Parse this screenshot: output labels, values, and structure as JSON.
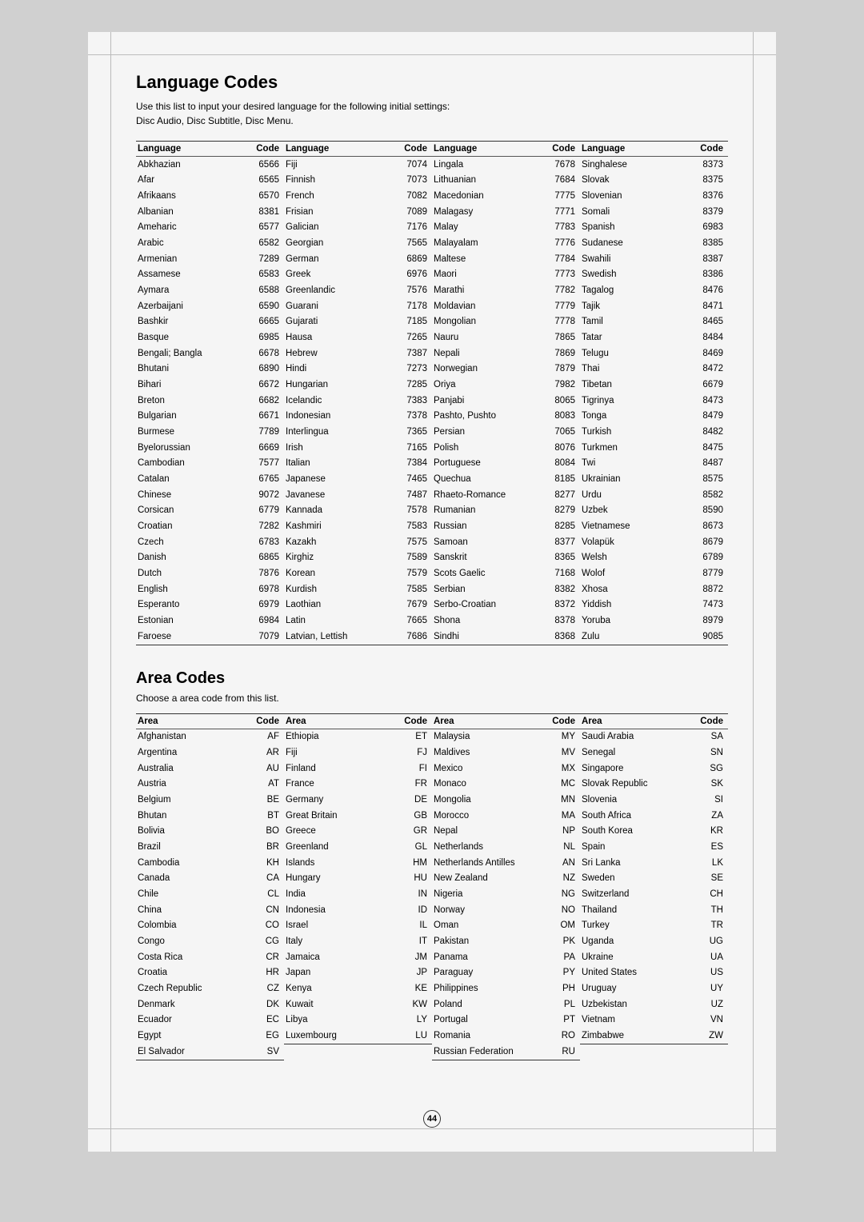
{
  "page": {
    "title": "Language Codes",
    "description_line1": "Use this list to input your desired language for the following initial settings:",
    "description_line2": "Disc Audio, Disc Subtitle, Disc Menu.",
    "area_title": "Area Codes",
    "area_desc": "Choose a area code from this list.",
    "page_number": "44"
  },
  "language_columns": [
    {
      "header": {
        "language": "Language",
        "code": "Code"
      },
      "rows": [
        {
          "language": "Abkhazian",
          "code": "6566"
        },
        {
          "language": "Afar",
          "code": "6565"
        },
        {
          "language": "Afrikaans",
          "code": "6570"
        },
        {
          "language": "Albanian",
          "code": "8381"
        },
        {
          "language": "Ameharic",
          "code": "6577"
        },
        {
          "language": "Arabic",
          "code": "6582"
        },
        {
          "language": "Armenian",
          "code": "7289"
        },
        {
          "language": "Assamese",
          "code": "6583"
        },
        {
          "language": "Aymara",
          "code": "6588"
        },
        {
          "language": "Azerbaijani",
          "code": "6590"
        },
        {
          "language": "Bashkir",
          "code": "6665"
        },
        {
          "language": "Basque",
          "code": "6985"
        },
        {
          "language": "Bengali; Bangla",
          "code": "6678"
        },
        {
          "language": "Bhutani",
          "code": "6890"
        },
        {
          "language": "Bihari",
          "code": "6672"
        },
        {
          "language": "Breton",
          "code": "6682"
        },
        {
          "language": "Bulgarian",
          "code": "6671"
        },
        {
          "language": "Burmese",
          "code": "7789"
        },
        {
          "language": "Byelorussian",
          "code": "6669"
        },
        {
          "language": "Cambodian",
          "code": "7577"
        },
        {
          "language": "Catalan",
          "code": "6765"
        },
        {
          "language": "Chinese",
          "code": "9072"
        },
        {
          "language": "Corsican",
          "code": "6779"
        },
        {
          "language": "Croatian",
          "code": "7282"
        },
        {
          "language": "Czech",
          "code": "6783"
        },
        {
          "language": "Danish",
          "code": "6865"
        },
        {
          "language": "Dutch",
          "code": "7876"
        },
        {
          "language": "English",
          "code": "6978"
        },
        {
          "language": "Esperanto",
          "code": "6979"
        },
        {
          "language": "Estonian",
          "code": "6984"
        },
        {
          "language": "Faroese",
          "code": "7079"
        }
      ]
    },
    {
      "header": {
        "language": "Language",
        "code": "Code"
      },
      "rows": [
        {
          "language": "Fiji",
          "code": "7074"
        },
        {
          "language": "Finnish",
          "code": "7073"
        },
        {
          "language": "French",
          "code": "7082"
        },
        {
          "language": "Frisian",
          "code": "7089"
        },
        {
          "language": "Galician",
          "code": "7176"
        },
        {
          "language": "Georgian",
          "code": "7565"
        },
        {
          "language": "German",
          "code": "6869"
        },
        {
          "language": "Greek",
          "code": "6976"
        },
        {
          "language": "Greenlandic",
          "code": "7576"
        },
        {
          "language": "Guarani",
          "code": "7178"
        },
        {
          "language": "Gujarati",
          "code": "7185"
        },
        {
          "language": "Hausa",
          "code": "7265"
        },
        {
          "language": "Hebrew",
          "code": "7387"
        },
        {
          "language": "Hindi",
          "code": "7273"
        },
        {
          "language": "Hungarian",
          "code": "7285"
        },
        {
          "language": "Icelandic",
          "code": "7383"
        },
        {
          "language": "Indonesian",
          "code": "7378"
        },
        {
          "language": "Interlingua",
          "code": "7365"
        },
        {
          "language": "Irish",
          "code": "7165"
        },
        {
          "language": "Italian",
          "code": "7384"
        },
        {
          "language": "Japanese",
          "code": "7465"
        },
        {
          "language": "Javanese",
          "code": "7487"
        },
        {
          "language": "Kannada",
          "code": "7578"
        },
        {
          "language": "Kashmiri",
          "code": "7583"
        },
        {
          "language": "Kazakh",
          "code": "7575"
        },
        {
          "language": "Kirghiz",
          "code": "7589"
        },
        {
          "language": "Korean",
          "code": "7579"
        },
        {
          "language": "Kurdish",
          "code": "7585"
        },
        {
          "language": "Laothian",
          "code": "7679"
        },
        {
          "language": "Latin",
          "code": "7665"
        },
        {
          "language": "Latvian, Lettish",
          "code": "7686"
        }
      ]
    },
    {
      "header": {
        "language": "Language",
        "code": "Code"
      },
      "rows": [
        {
          "language": "Lingala",
          "code": "7678"
        },
        {
          "language": "Lithuanian",
          "code": "7684"
        },
        {
          "language": "Macedonian",
          "code": "7775"
        },
        {
          "language": "Malagasy",
          "code": "7771"
        },
        {
          "language": "Malay",
          "code": "7783"
        },
        {
          "language": "Malayalam",
          "code": "7776"
        },
        {
          "language": "Maltese",
          "code": "7784"
        },
        {
          "language": "Maori",
          "code": "7773"
        },
        {
          "language": "Marathi",
          "code": "7782"
        },
        {
          "language": "Moldavian",
          "code": "7779"
        },
        {
          "language": "Mongolian",
          "code": "7778"
        },
        {
          "language": "Nauru",
          "code": "7865"
        },
        {
          "language": "Nepali",
          "code": "7869"
        },
        {
          "language": "Norwegian",
          "code": "7879"
        },
        {
          "language": "Oriya",
          "code": "7982"
        },
        {
          "language": "Panjabi",
          "code": "8065"
        },
        {
          "language": "Pashto, Pushto",
          "code": "8083"
        },
        {
          "language": "Persian",
          "code": "7065"
        },
        {
          "language": "Polish",
          "code": "8076"
        },
        {
          "language": "Portuguese",
          "code": "8084"
        },
        {
          "language": "Quechua",
          "code": "8185"
        },
        {
          "language": "Rhaeto-Romance",
          "code": "8277"
        },
        {
          "language": "Rumanian",
          "code": "8279"
        },
        {
          "language": "Russian",
          "code": "8285"
        },
        {
          "language": "Samoan",
          "code": "8377"
        },
        {
          "language": "Sanskrit",
          "code": "8365"
        },
        {
          "language": "Scots Gaelic",
          "code": "7168"
        },
        {
          "language": "Serbian",
          "code": "8382"
        },
        {
          "language": "Serbo-Croatian",
          "code": "8372"
        },
        {
          "language": "Shona",
          "code": "8378"
        },
        {
          "language": "Sindhi",
          "code": "8368"
        }
      ]
    },
    {
      "header": {
        "language": "Language",
        "code": "Code"
      },
      "rows": [
        {
          "language": "Singhalese",
          "code": "8373"
        },
        {
          "language": "Slovak",
          "code": "8375"
        },
        {
          "language": "Slovenian",
          "code": "8376"
        },
        {
          "language": "Somali",
          "code": "8379"
        },
        {
          "language": "Spanish",
          "code": "6983"
        },
        {
          "language": "Sudanese",
          "code": "8385"
        },
        {
          "language": "Swahili",
          "code": "8387"
        },
        {
          "language": "Swedish",
          "code": "8386"
        },
        {
          "language": "Tagalog",
          "code": "8476"
        },
        {
          "language": "Tajik",
          "code": "8471"
        },
        {
          "language": "Tamil",
          "code": "8465"
        },
        {
          "language": "Tatar",
          "code": "8484"
        },
        {
          "language": "Telugu",
          "code": "8469"
        },
        {
          "language": "Thai",
          "code": "8472"
        },
        {
          "language": "Tibetan",
          "code": "6679"
        },
        {
          "language": "Tigrinya",
          "code": "8473"
        },
        {
          "language": "Tonga",
          "code": "8479"
        },
        {
          "language": "Turkish",
          "code": "8482"
        },
        {
          "language": "Turkmen",
          "code": "8475"
        },
        {
          "language": "Twi",
          "code": "8487"
        },
        {
          "language": "Ukrainian",
          "code": "8575"
        },
        {
          "language": "Urdu",
          "code": "8582"
        },
        {
          "language": "Uzbek",
          "code": "8590"
        },
        {
          "language": "Vietnamese",
          "code": "8673"
        },
        {
          "language": "Volapük",
          "code": "8679"
        },
        {
          "language": "Welsh",
          "code": "6789"
        },
        {
          "language": "Wolof",
          "code": "8779"
        },
        {
          "language": "Xhosa",
          "code": "8872"
        },
        {
          "language": "Yiddish",
          "code": "7473"
        },
        {
          "language": "Yoruba",
          "code": "8979"
        },
        {
          "language": "Zulu",
          "code": "9085"
        }
      ]
    }
  ],
  "area_columns": [
    {
      "header": {
        "area": "Area",
        "code": "Code"
      },
      "rows": [
        {
          "area": "Afghanistan",
          "code": "AF"
        },
        {
          "area": "Argentina",
          "code": "AR"
        },
        {
          "area": "Australia",
          "code": "AU"
        },
        {
          "area": "Austria",
          "code": "AT"
        },
        {
          "area": "Belgium",
          "code": "BE"
        },
        {
          "area": "Bhutan",
          "code": "BT"
        },
        {
          "area": "Bolivia",
          "code": "BO"
        },
        {
          "area": "Brazil",
          "code": "BR"
        },
        {
          "area": "Cambodia",
          "code": "KH"
        },
        {
          "area": "Canada",
          "code": "CA"
        },
        {
          "area": "Chile",
          "code": "CL"
        },
        {
          "area": "China",
          "code": "CN"
        },
        {
          "area": "Colombia",
          "code": "CO"
        },
        {
          "area": "Congo",
          "code": "CG"
        },
        {
          "area": "Costa Rica",
          "code": "CR"
        },
        {
          "area": "Croatia",
          "code": "HR"
        },
        {
          "area": "Czech Republic",
          "code": "CZ"
        },
        {
          "area": "Denmark",
          "code": "DK"
        },
        {
          "area": "Ecuador",
          "code": "EC"
        },
        {
          "area": "Egypt",
          "code": "EG"
        },
        {
          "area": "El Salvador",
          "code": "SV"
        }
      ]
    },
    {
      "header": {
        "area": "Area",
        "code": "Code"
      },
      "rows": [
        {
          "area": "Ethiopia",
          "code": "ET"
        },
        {
          "area": "Fiji",
          "code": "FJ"
        },
        {
          "area": "Finland",
          "code": "FI"
        },
        {
          "area": "France",
          "code": "FR"
        },
        {
          "area": "Germany",
          "code": "DE"
        },
        {
          "area": "Great Britain",
          "code": "GB"
        },
        {
          "area": "Greece",
          "code": "GR"
        },
        {
          "area": "Greenland",
          "code": "GL"
        },
        {
          "area": "Islands",
          "code": "HM"
        },
        {
          "area": "Hungary",
          "code": "HU"
        },
        {
          "area": "India",
          "code": "IN"
        },
        {
          "area": "Indonesia",
          "code": "ID"
        },
        {
          "area": "Israel",
          "code": "IL"
        },
        {
          "area": "Italy",
          "code": "IT"
        },
        {
          "area": "Jamaica",
          "code": "JM"
        },
        {
          "area": "Japan",
          "code": "JP"
        },
        {
          "area": "Kenya",
          "code": "KE"
        },
        {
          "area": "Kuwait",
          "code": "KW"
        },
        {
          "area": "Libya",
          "code": "LY"
        },
        {
          "area": "Luxembourg",
          "code": "LU"
        }
      ]
    },
    {
      "header": {
        "area": "Area",
        "code": "Code"
      },
      "rows": [
        {
          "area": "Malaysia",
          "code": "MY"
        },
        {
          "area": "Maldives",
          "code": "MV"
        },
        {
          "area": "Mexico",
          "code": "MX"
        },
        {
          "area": "Monaco",
          "code": "MC"
        },
        {
          "area": "Mongolia",
          "code": "MN"
        },
        {
          "area": "Morocco",
          "code": "MA"
        },
        {
          "area": "Nepal",
          "code": "NP"
        },
        {
          "area": "Netherlands",
          "code": "NL"
        },
        {
          "area": "Netherlands Antilles",
          "code": "AN"
        },
        {
          "area": "New Zealand",
          "code": "NZ"
        },
        {
          "area": "Nigeria",
          "code": "NG"
        },
        {
          "area": "Norway",
          "code": "NO"
        },
        {
          "area": "Oman",
          "code": "OM"
        },
        {
          "area": "Pakistan",
          "code": "PK"
        },
        {
          "area": "Panama",
          "code": "PA"
        },
        {
          "area": "Paraguay",
          "code": "PY"
        },
        {
          "area": "Philippines",
          "code": "PH"
        },
        {
          "area": "Poland",
          "code": "PL"
        },
        {
          "area": "Portugal",
          "code": "PT"
        },
        {
          "area": "Romania",
          "code": "RO"
        },
        {
          "area": "Russian Federation",
          "code": "RU"
        }
      ]
    },
    {
      "header": {
        "area": "Area",
        "code": "Code"
      },
      "rows": [
        {
          "area": "Saudi Arabia",
          "code": "SA"
        },
        {
          "area": "Senegal",
          "code": "SN"
        },
        {
          "area": "Singapore",
          "code": "SG"
        },
        {
          "area": "Slovak Republic",
          "code": "SK"
        },
        {
          "area": "Slovenia",
          "code": "SI"
        },
        {
          "area": "South Africa",
          "code": "ZA"
        },
        {
          "area": "South Korea",
          "code": "KR"
        },
        {
          "area": "Spain",
          "code": "ES"
        },
        {
          "area": "Sri Lanka",
          "code": "LK"
        },
        {
          "area": "Sweden",
          "code": "SE"
        },
        {
          "area": "Switzerland",
          "code": "CH"
        },
        {
          "area": "Thailand",
          "code": "TH"
        },
        {
          "area": "Turkey",
          "code": "TR"
        },
        {
          "area": "Uganda",
          "code": "UG"
        },
        {
          "area": "Ukraine",
          "code": "UA"
        },
        {
          "area": "United States",
          "code": "US"
        },
        {
          "area": "Uruguay",
          "code": "UY"
        },
        {
          "area": "Uzbekistan",
          "code": "UZ"
        },
        {
          "area": "Vietnam",
          "code": "VN"
        },
        {
          "area": "Zimbabwe",
          "code": "ZW"
        }
      ]
    }
  ]
}
